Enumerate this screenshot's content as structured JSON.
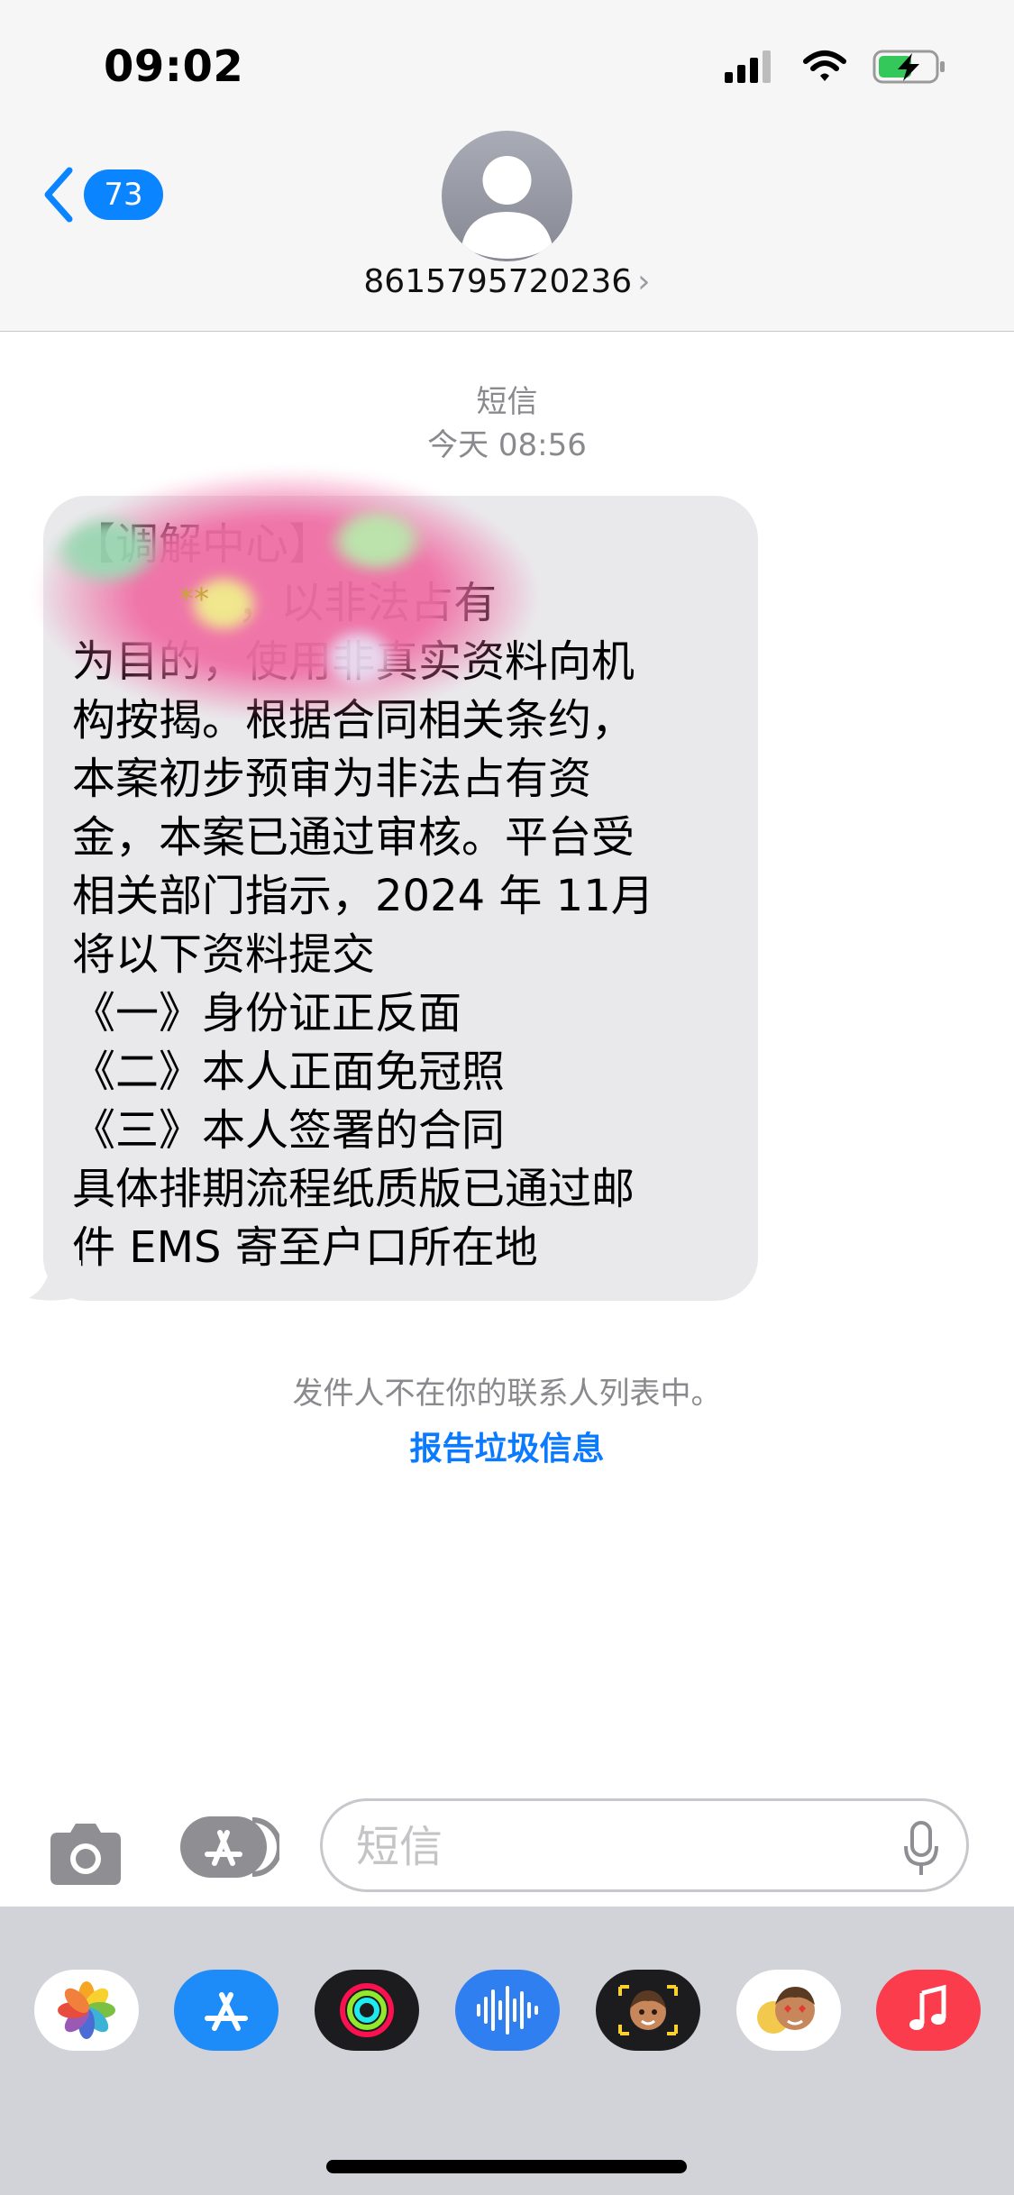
{
  "status_bar": {
    "time": "09:02"
  },
  "nav": {
    "back_count": "73",
    "contact_number": "8615795720236",
    "chevron": "›"
  },
  "thread": {
    "service_label": "短信",
    "timestamp": "今天 08:56"
  },
  "message": {
    "text": "【调解中心】\n            ，以非法占有\n为目的，使用非真实资料向机\n构按揭。根据合同相关条约，\n本案初步预审为非法占有资\n金，本案已通过审核。平台受\n相关部门指示，2024 年 11月\n将以下资料提交\n《一》身份证正反面\n《二》本人正面免冠照\n《三》本人签署的合同\n具体排期流程纸质版已通过邮\n件 EMS 寄至户口所在地",
    "masked": "**"
  },
  "notice": {
    "text": "发件人不在你的联系人列表中。",
    "report_label": "报告垃圾信息"
  },
  "input": {
    "placeholder": "短信"
  },
  "dock": {
    "apps": [
      "photos-icon",
      "app-store-icon",
      "activity-icon",
      "voice-memo-icon",
      "memoji-camera-icon",
      "memoji-stickers-icon",
      "music-icon"
    ]
  },
  "colors": {
    "accent": "#0a84ff",
    "bubble": "#e9e9eb",
    "dock": "#d1d3d9"
  }
}
